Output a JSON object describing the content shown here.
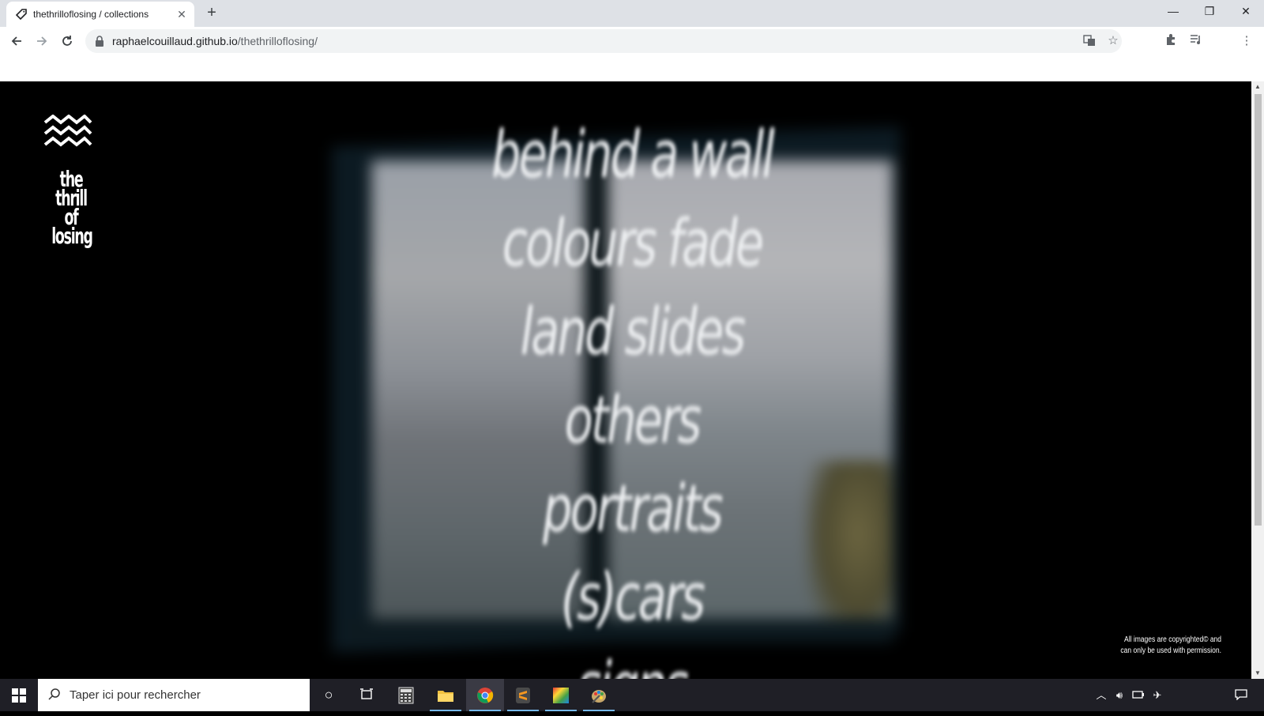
{
  "browser": {
    "tab_title": "thethrilloflosing / collections",
    "tab_close": "✕",
    "new_tab": "+",
    "url_host": "raphaelcouillaud.github.io",
    "url_path": "/thethrilloflosing/",
    "window_controls": {
      "minimize": "—",
      "restore": "❐",
      "close": "✕"
    }
  },
  "page": {
    "logo_lines": [
      "the",
      "thrill",
      "of",
      "losing"
    ],
    "menu": [
      "behind a wall",
      "colours fade",
      "land slides",
      "others",
      "portraits",
      "(s)cars",
      "signs"
    ],
    "copyright_line1": "All images are copyrighted© and",
    "copyright_line2": "can only be used with permission."
  },
  "taskbar": {
    "search_placeholder": "Taper ici pour rechercher",
    "apps": [
      "cortana-icon",
      "task-view-icon",
      "calculator-icon",
      "file-explorer-icon",
      "chrome-icon",
      "sublime-icon",
      "color-app-icon",
      "paint-icon"
    ],
    "accent": "#76b9ed"
  }
}
